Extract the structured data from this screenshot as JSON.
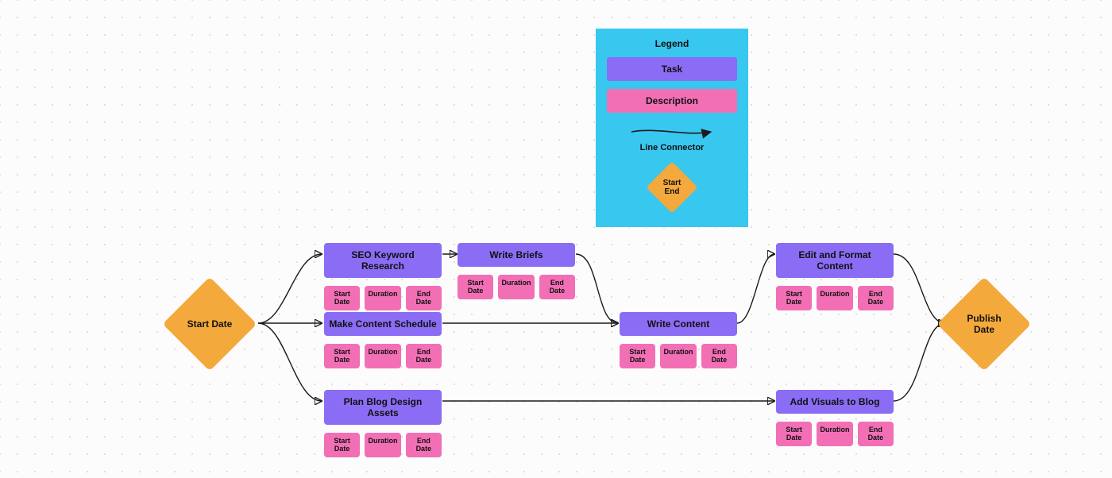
{
  "diamonds": {
    "start": "Start Date",
    "publish": "Publish\nDate"
  },
  "desc_labels": {
    "start": "Start\nDate",
    "duration": "Duration",
    "end": "End\nDate"
  },
  "tasks": {
    "seo": {
      "title": "SEO Keyword Research"
    },
    "briefs": {
      "title": "Write Briefs"
    },
    "sched": {
      "title": "Make Content Schedule"
    },
    "write": {
      "title": "Write Content"
    },
    "plan": {
      "title": "Plan Blog Design Assets"
    },
    "edit": {
      "title": "Edit and Format Content"
    },
    "visuals": {
      "title": "Add Visuals to Blog"
    }
  },
  "legend": {
    "title": "Legend",
    "task": "Task",
    "description": "Description",
    "connector": "Line Connector",
    "start_end": "Start\nEnd"
  },
  "colors": {
    "task": "#8a6df4",
    "description": "#f26fb6",
    "diamond": "#f3a93c",
    "legend_bg": "#38c7ef"
  }
}
